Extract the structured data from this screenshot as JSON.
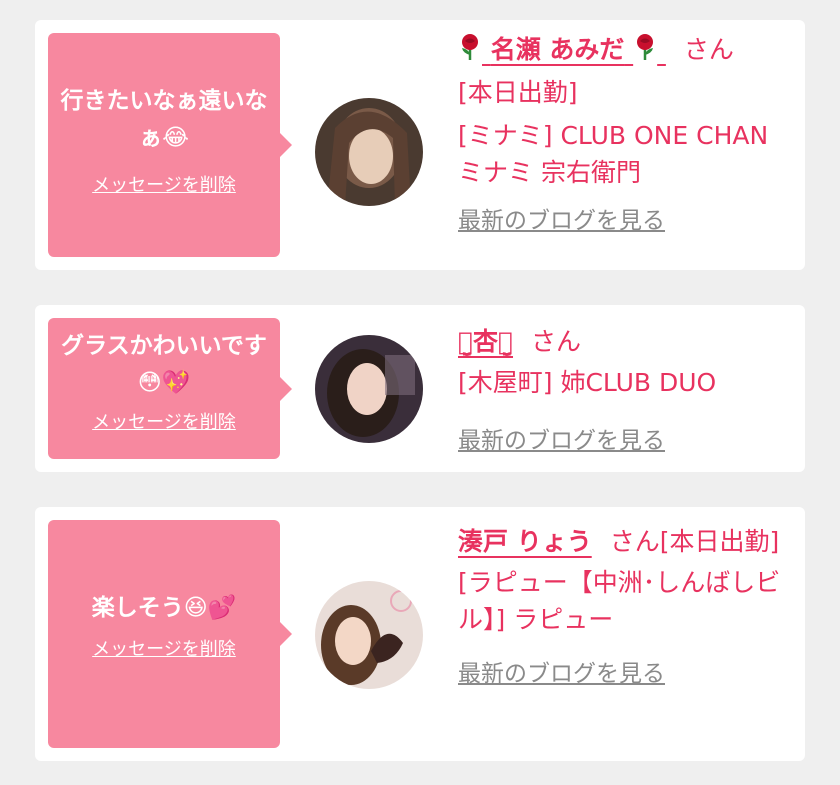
{
  "cards": [
    {
      "message": "行きたいなぁ遠いなぁ😂",
      "delete_label": "メッセージを削除",
      "name": "名瀬 あみだ",
      "honorific": "さん",
      "status": "[本日出勤]",
      "shop": "[ミナミ] CLUB ONE CHAN ミナミ 宗右衛門",
      "blog_label": "最新のブログを見る"
    },
    {
      "message": "グラスかわいいです😳💖",
      "delete_label": "メッセージを削除",
      "name": "ꪔ̤̮杏ꪔ̤̮",
      "honorific": "さん",
      "shop": "[木屋町] 姉CLUB DUO",
      "blog_label": "最新のブログを見る"
    },
    {
      "message": "楽しそう😆💕",
      "delete_label": "メッセージを削除",
      "name": "湊戸 りょう",
      "honorific": "さん[本日出勤]",
      "shop": "[ラピュー【中洲･しんばしビル】] ラピュー",
      "blog_label": "最新のブログを見る"
    }
  ],
  "colors": {
    "accent": "#e8325f",
    "bubble": "#f7889f",
    "muted": "#8a8a8a",
    "background": "#efefef"
  },
  "icons": [
    "rose-icon"
  ]
}
